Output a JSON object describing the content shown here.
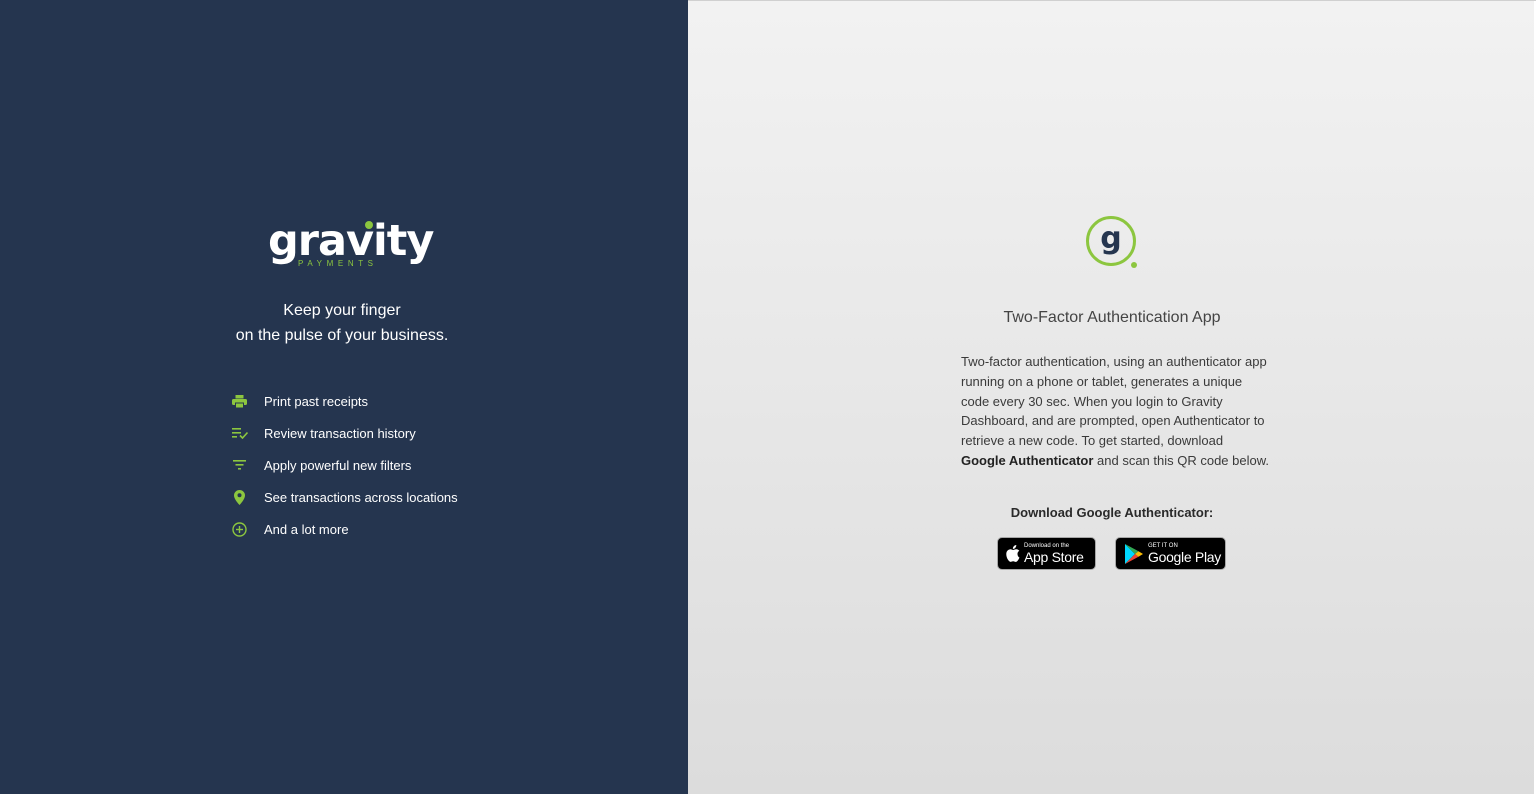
{
  "brand": {
    "logo_word": "gravity",
    "logo_sub": "PAYMENTS",
    "accent_color": "#8cc63f",
    "panel_color": "#25354f"
  },
  "left": {
    "tagline_line1": "Keep your finger",
    "tagline_line2": "on the pulse of your business.",
    "features": [
      {
        "icon": "printer-icon",
        "label": "Print past receipts"
      },
      {
        "icon": "list-check-icon",
        "label": "Review transaction history"
      },
      {
        "icon": "filter-icon",
        "label": "Apply powerful new filters"
      },
      {
        "icon": "location-pin-icon",
        "label": "See transactions across locations"
      },
      {
        "icon": "plus-circle-icon",
        "label": "And a lot more"
      }
    ]
  },
  "right": {
    "logo_icon": "gravity-g-icon",
    "title": "Two-Factor Authentication App",
    "description_part1": "Two-factor authentication, using an authenticator app running on a phone or tablet, generates a unique code every 30 sec. When you login to Gravity Dashboard, and are prompted, open Authenticator to retrieve a new code. To get started, download ",
    "description_bold": "Google Authenticator",
    "description_part2": " and scan this QR code below.",
    "download_label": "Download Google Authenticator:",
    "app_store": {
      "small": "Download on the",
      "big": "App Store",
      "icon": "apple-icon"
    },
    "google_play": {
      "small": "GET IT ON",
      "big": "Google Play",
      "icon": "google-play-icon"
    }
  }
}
